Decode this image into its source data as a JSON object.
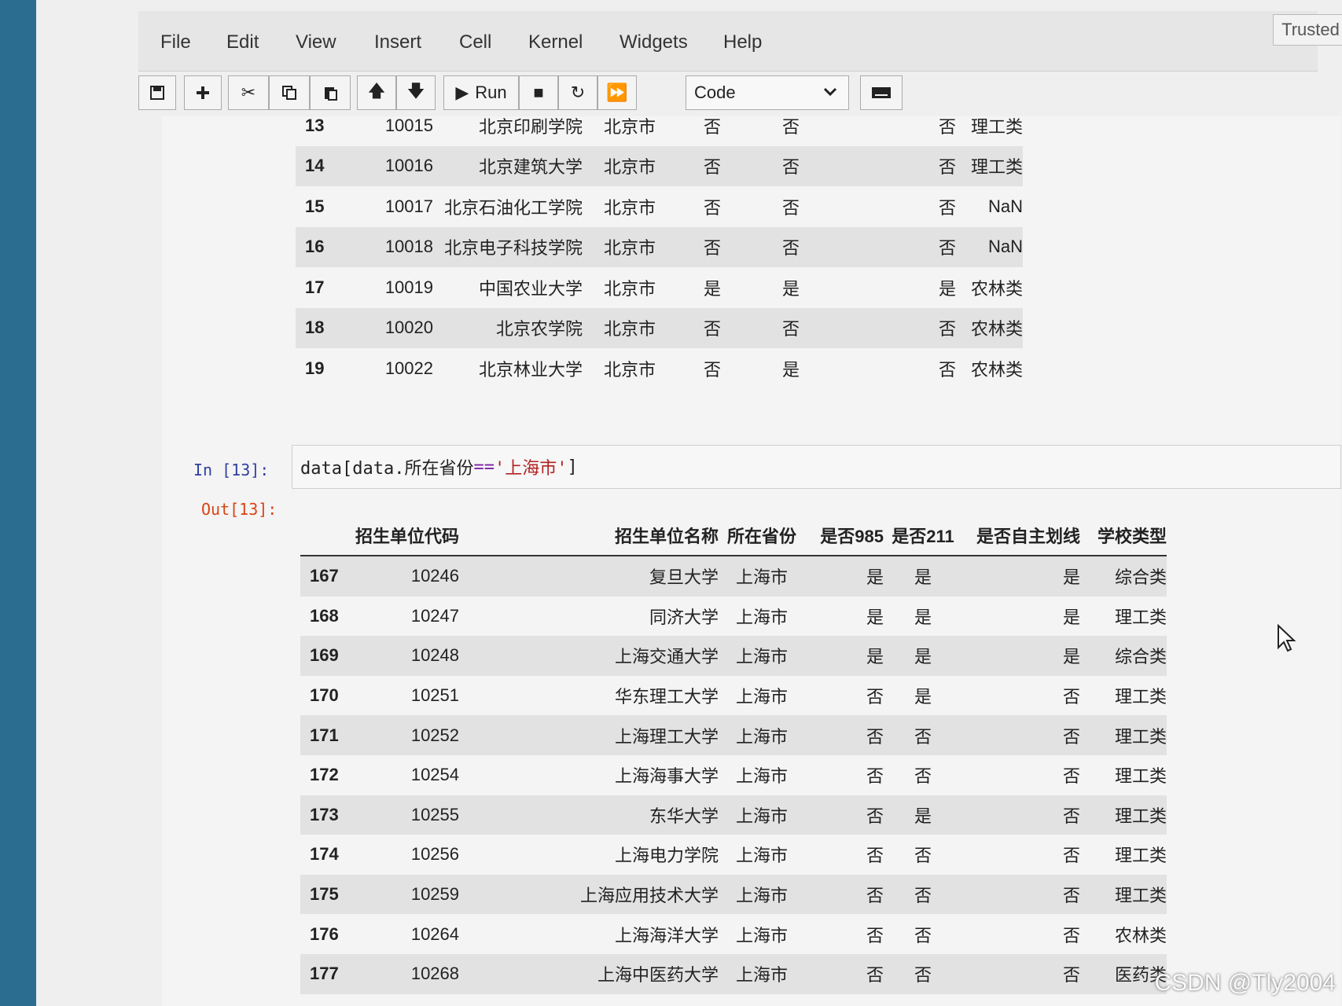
{
  "menu": [
    "File",
    "Edit",
    "View",
    "Insert",
    "Cell",
    "Kernel",
    "Widgets",
    "Help"
  ],
  "trusted": "Trusted",
  "toolbar": {
    "run_label": "Run",
    "cell_type": "Code",
    "icons": [
      "save-icon",
      "plus-icon",
      "scissors-icon",
      "copy-icon",
      "paste-icon",
      "arrow-up-icon",
      "arrow-down-icon",
      "run-icon",
      "stop-icon",
      "restart-icon",
      "fast-forward-icon",
      "keyboard-icon"
    ]
  },
  "table1": {
    "rows": [
      [
        "13",
        "10015",
        "北京印刷学院",
        "北京市",
        "否",
        "否",
        "否",
        "理工类"
      ],
      [
        "14",
        "10016",
        "北京建筑大学",
        "北京市",
        "否",
        "否",
        "否",
        "理工类"
      ],
      [
        "15",
        "10017",
        "北京石油化工学院",
        "北京市",
        "否",
        "否",
        "否",
        "NaN"
      ],
      [
        "16",
        "10018",
        "北京电子科技学院",
        "北京市",
        "否",
        "否",
        "否",
        "NaN"
      ],
      [
        "17",
        "10019",
        "中国农业大学",
        "北京市",
        "是",
        "是",
        "是",
        "农林类"
      ],
      [
        "18",
        "10020",
        "北京农学院",
        "北京市",
        "否",
        "否",
        "否",
        "农林类"
      ],
      [
        "19",
        "10022",
        "北京林业大学",
        "北京市",
        "否",
        "是",
        "否",
        "农林类"
      ]
    ]
  },
  "cell13": {
    "in_prompt": "In  [13]:",
    "out_prompt": "Out[13]:",
    "code_prefix": "data[data.所在省份",
    "code_op": "==",
    "code_str": "'上海市'",
    "code_suffix": "]"
  },
  "table2": {
    "headers": [
      "",
      "招生单位代码",
      "招生单位名称",
      "所在省份",
      "是否985",
      "是否211",
      "是否自主划线",
      "学校类型"
    ],
    "rows": [
      [
        "167",
        "10246",
        "复旦大学",
        "上海市",
        "是",
        "是",
        "是",
        "综合类"
      ],
      [
        "168",
        "10247",
        "同济大学",
        "上海市",
        "是",
        "是",
        "是",
        "理工类"
      ],
      [
        "169",
        "10248",
        "上海交通大学",
        "上海市",
        "是",
        "是",
        "是",
        "综合类"
      ],
      [
        "170",
        "10251",
        "华东理工大学",
        "上海市",
        "否",
        "是",
        "否",
        "理工类"
      ],
      [
        "171",
        "10252",
        "上海理工大学",
        "上海市",
        "否",
        "否",
        "否",
        "理工类"
      ],
      [
        "172",
        "10254",
        "上海海事大学",
        "上海市",
        "否",
        "否",
        "否",
        "理工类"
      ],
      [
        "173",
        "10255",
        "东华大学",
        "上海市",
        "否",
        "是",
        "否",
        "理工类"
      ],
      [
        "174",
        "10256",
        "上海电力学院",
        "上海市",
        "否",
        "否",
        "否",
        "理工类"
      ],
      [
        "175",
        "10259",
        "上海应用技术大学",
        "上海市",
        "否",
        "否",
        "否",
        "理工类"
      ],
      [
        "176",
        "10264",
        "上海海洋大学",
        "上海市",
        "否",
        "否",
        "否",
        "农林类"
      ],
      [
        "177",
        "10268",
        "上海中医药大学",
        "上海市",
        "否",
        "否",
        "否",
        "医药类"
      ]
    ]
  },
  "watermark": "CSDN @Tly2004"
}
